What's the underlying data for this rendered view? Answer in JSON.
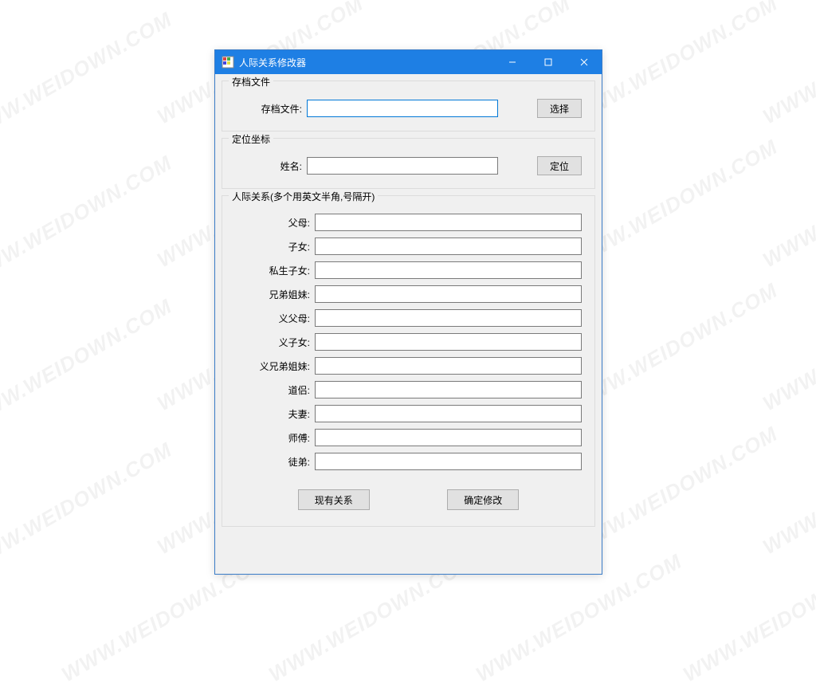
{
  "watermark_text": "WWW.WEIDOWN.COM",
  "window": {
    "title": "人际关系修改器"
  },
  "group1": {
    "title": "存档文件",
    "file_label": "存档文件:",
    "file_value": "",
    "select_btn": "选择"
  },
  "group2": {
    "title": "定位坐标",
    "name_label": "姓名:",
    "name_value": "",
    "locate_btn": "定位"
  },
  "group3": {
    "title": "人际关系(多个用英文半角,号隔开)",
    "rows": [
      {
        "label": "父母:",
        "value": ""
      },
      {
        "label": "子女:",
        "value": ""
      },
      {
        "label": "私生子女:",
        "value": ""
      },
      {
        "label": "兄弟姐妹:",
        "value": ""
      },
      {
        "label": "义父母:",
        "value": ""
      },
      {
        "label": "义子女:",
        "value": ""
      },
      {
        "label": "义兄弟姐妹:",
        "value": ""
      },
      {
        "label": "道侣:",
        "value": ""
      },
      {
        "label": "夫妻:",
        "value": ""
      },
      {
        "label": "师傅:",
        "value": ""
      },
      {
        "label": "徒弟:",
        "value": ""
      }
    ],
    "btn_existing": "现有关系",
    "btn_confirm": "确定修改"
  }
}
